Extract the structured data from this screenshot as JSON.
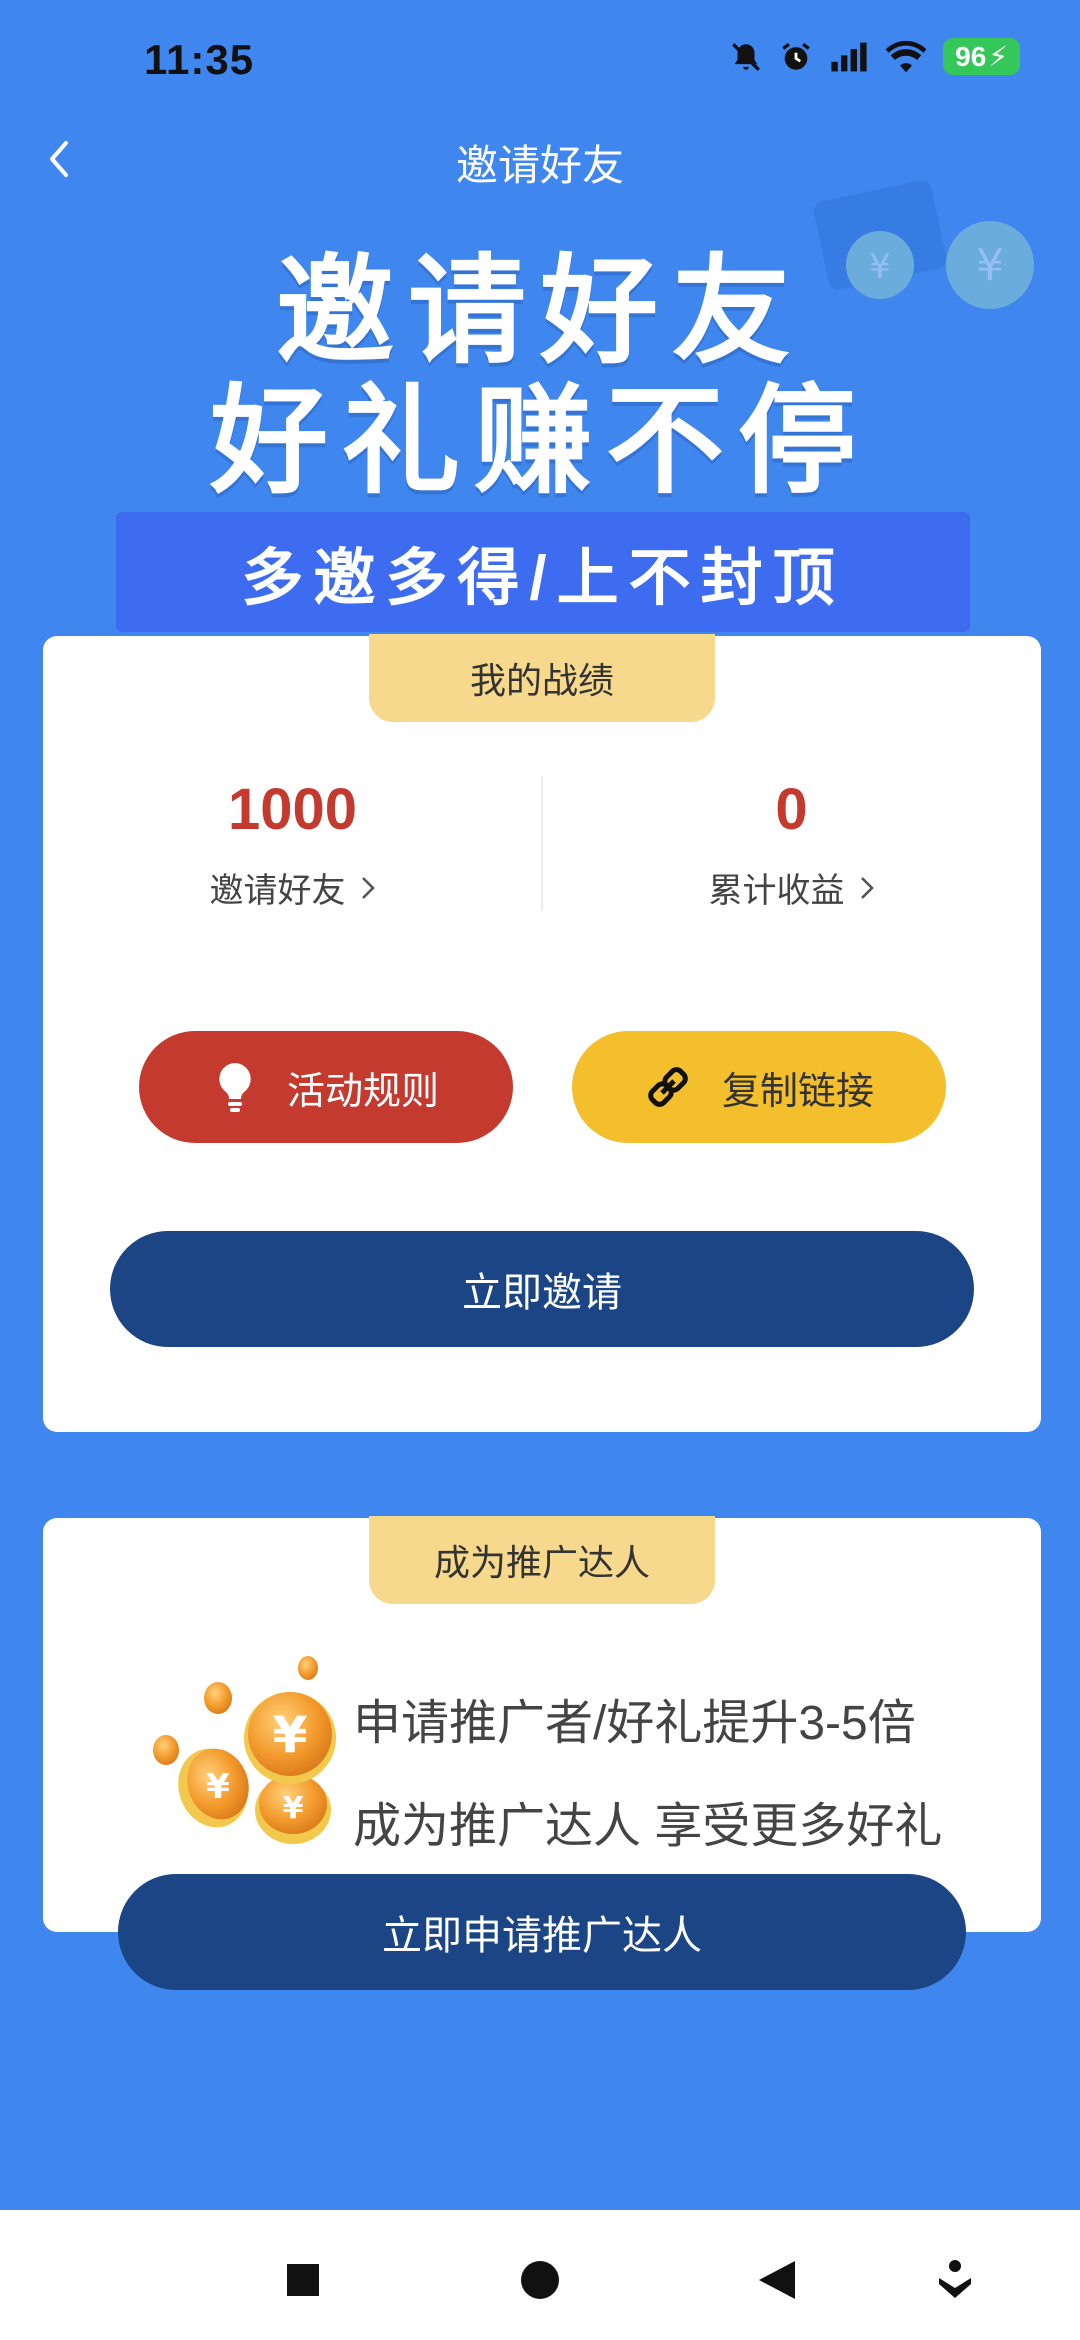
{
  "status_bar": {
    "time": "11:35",
    "battery": "96",
    "icons": [
      "mute-bell-icon",
      "alarm-icon",
      "signal-icon",
      "wifi-icon",
      "battery-icon"
    ]
  },
  "header": {
    "title": "邀请好友",
    "back_icon": "chevron-left-icon"
  },
  "hero": {
    "line1": "邀请好友",
    "line2": "好礼赚不停",
    "banner": "多邀多得/上不封顶"
  },
  "record_card": {
    "tab_label": "我的战绩",
    "stats": [
      {
        "value": "1000",
        "label": "邀请好友"
      },
      {
        "value": "0",
        "label": "累计收益"
      }
    ],
    "rules_button": "活动规则",
    "copy_button": "复制链接",
    "invite_button": "立即邀请"
  },
  "promo_card": {
    "tab_label": "成为推广达人",
    "line1": "申请推广者/好礼提升3-5倍",
    "line2": "成为推广达人 享受更多好礼",
    "apply_button": "立即申请推广达人"
  },
  "colors": {
    "background": "#3f87ee",
    "banner": "#3d6cf1",
    "stat_value": "#c43a2e",
    "rules_button": "#c43a2e",
    "copy_button": "#f4bf2c",
    "primary_button": "#1b4584",
    "tab": "#f7d98d"
  },
  "nav_bar": {
    "icons": [
      "recents-square-icon",
      "home-circle-icon",
      "back-triangle-icon",
      "accessibility-icon"
    ]
  }
}
